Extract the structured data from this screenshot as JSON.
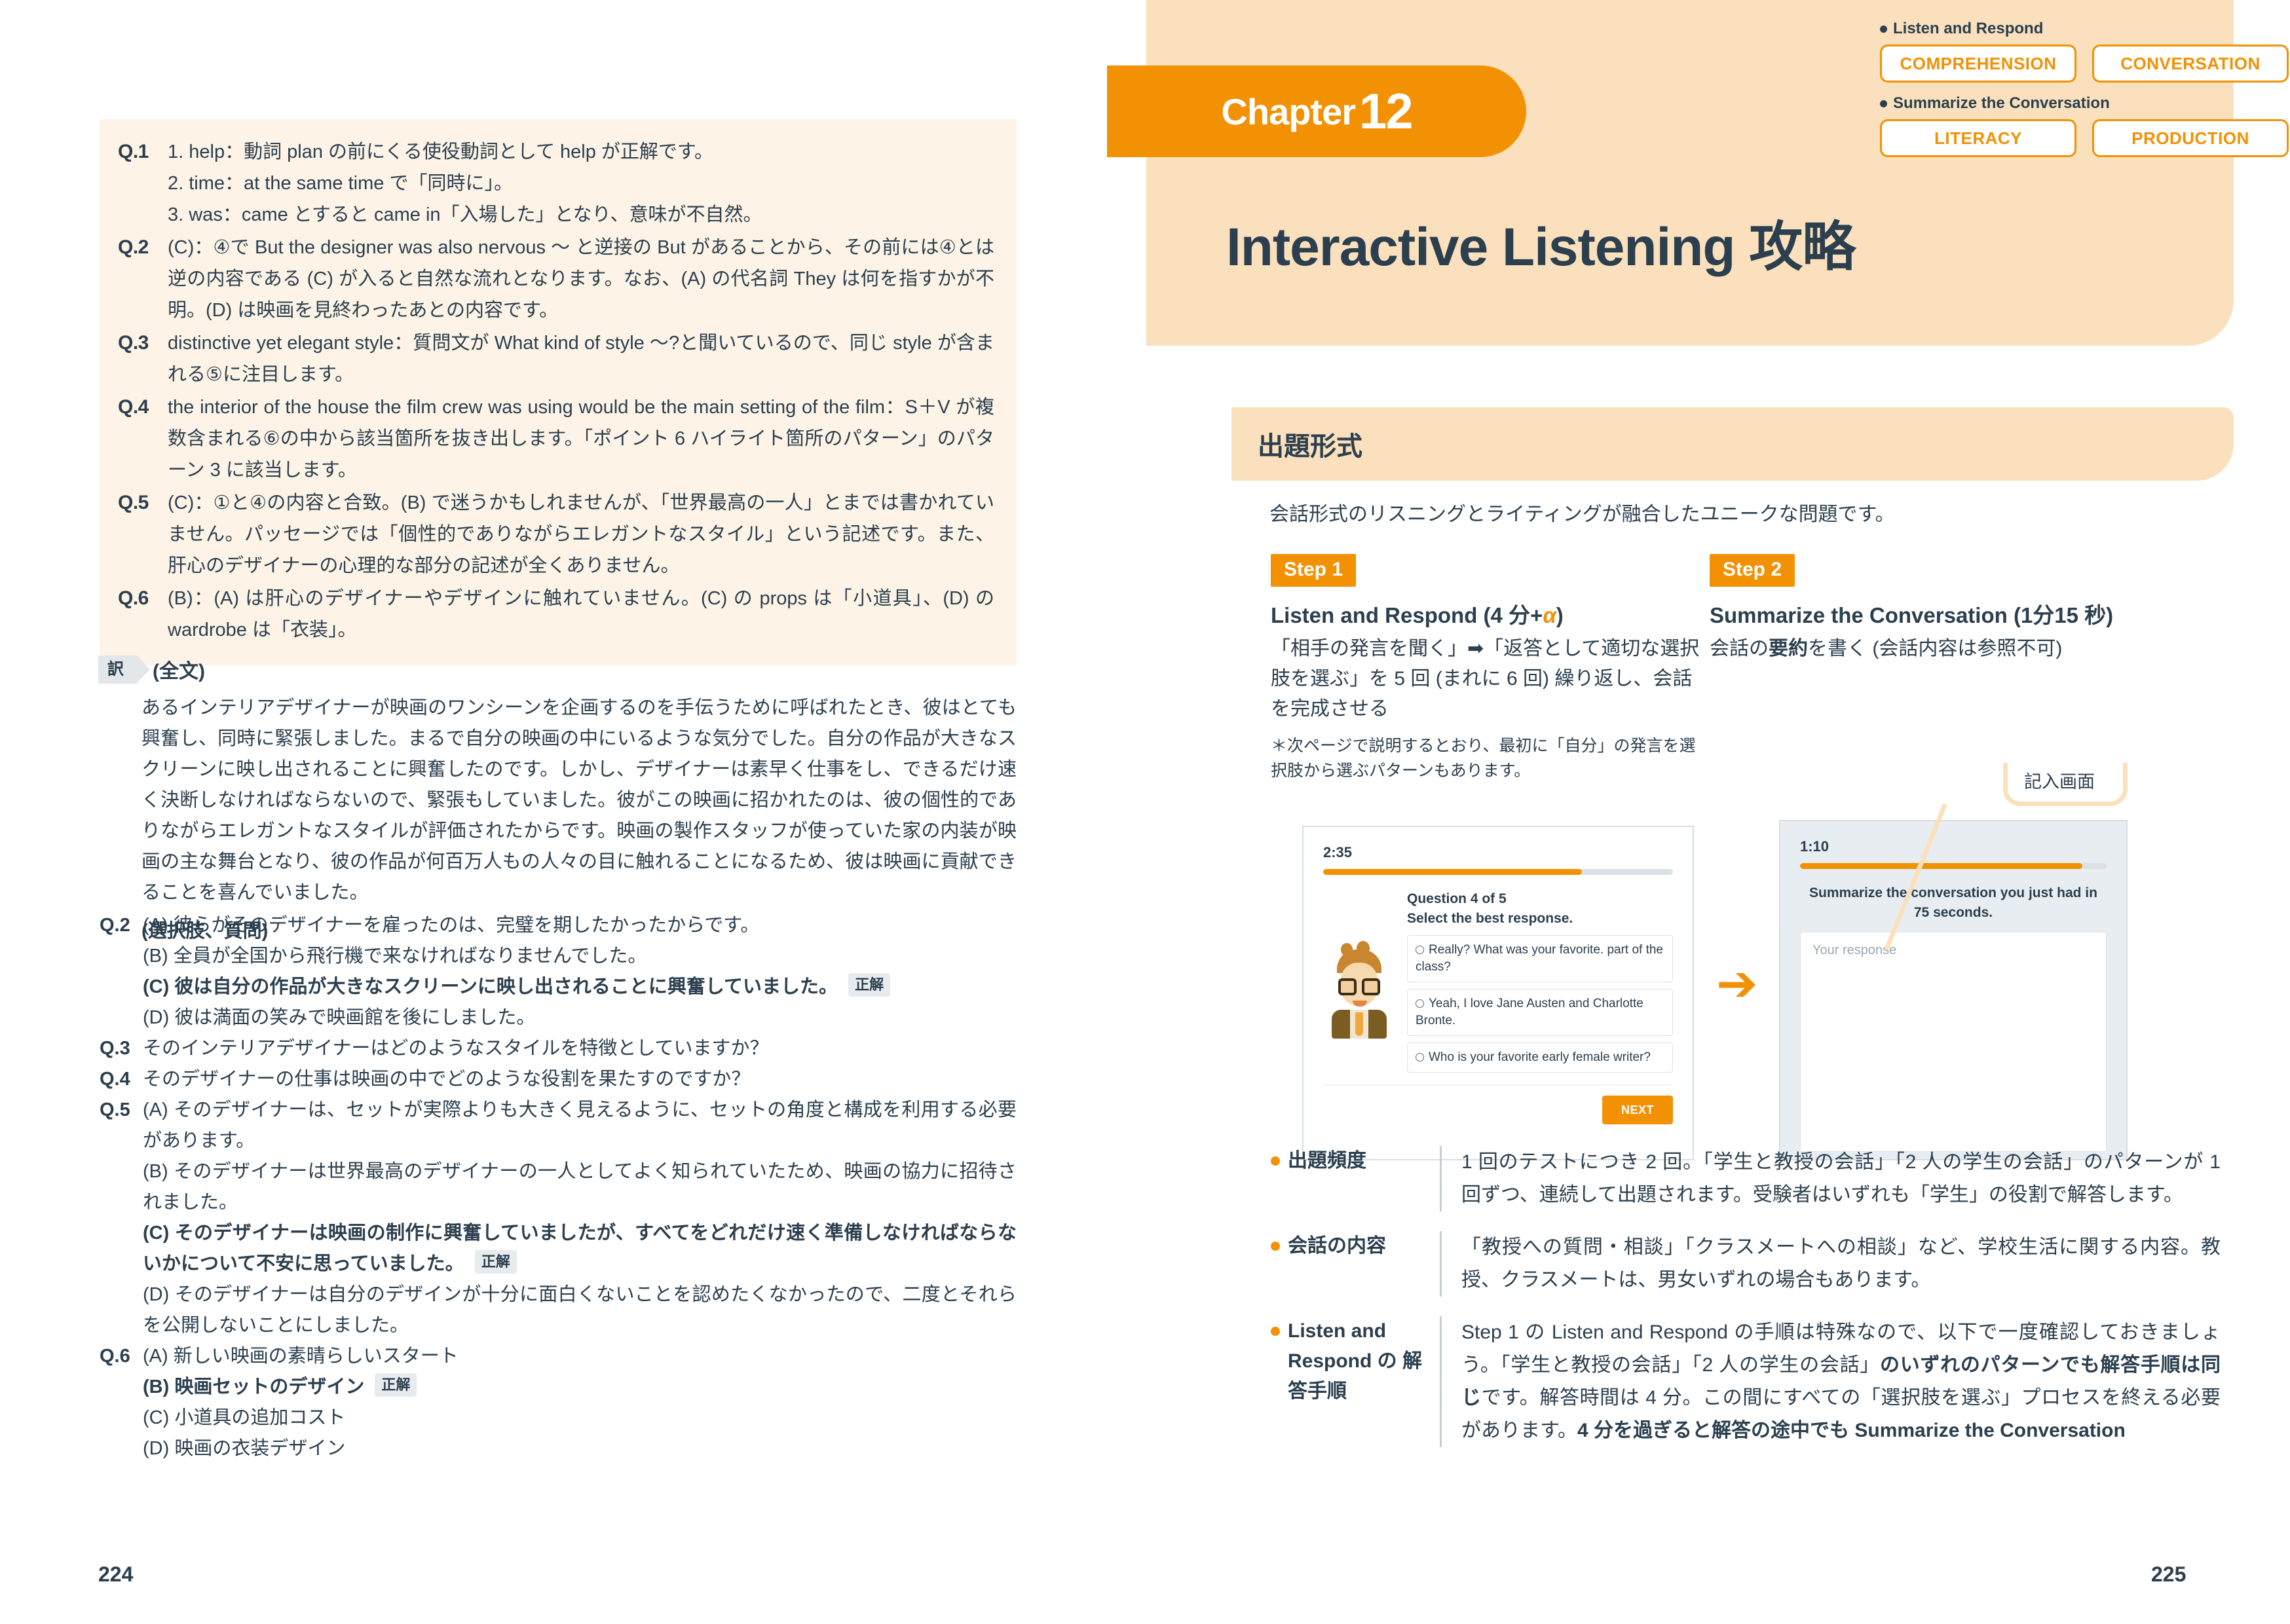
{
  "left_page": {
    "page_number": "224",
    "explanations": [
      {
        "label": "Q.1",
        "lines": [
          "1. help：動詞 plan の前にくる使役動詞として help が正解です。",
          "2. time：at the same time で「同時に」。",
          "3. was：came とすると came in「入場した」となり、意味が不自然。"
        ]
      },
      {
        "label": "Q.2",
        "lines": [
          "(C)：④で But the designer was also nervous 〜 と逆接の But があることから、その前には④とは逆の内容である (C) が入ると自然な流れとなります。なお、(A) の代名詞 They は何を指すかが不明。(D) は映画を見終わったあとの内容です。"
        ]
      },
      {
        "label": "Q.3",
        "lines": [
          "distinctive yet elegant style：質問文が What kind of style 〜?と聞いているので、同じ style が含まれる⑤に注目します。"
        ]
      },
      {
        "label": "Q.4",
        "lines": [
          "the interior of the house the film crew was using would be the main setting of the film：S＋V が複数含まれる⑥の中から該当箇所を抜き出します。「ポイント 6 ハイライト箇所のパターン」のパターン 3 に該当します。"
        ]
      },
      {
        "label": "Q.5",
        "lines": [
          "(C)：①と④の内容と合致。(B) で迷うかもしれませんが、「世界最高の一人」とまでは書かれていません。パッセージでは「個性的でありながらエレガントなスタイル」という記述です。また、肝心のデザイナーの心理的な部分の記述が全くありません。"
        ]
      },
      {
        "label": "Q.6",
        "lines": [
          "(B)：(A) は肝心のデザイナーやデザインに触れていません。(C) の props は「小道具」、(D) の wardrobe は「衣装」。"
        ]
      }
    ],
    "translation": {
      "tag": "訳",
      "title": "(全文)",
      "body": "あるインテリアデザイナーが映画のワンシーンを企画するのを手伝うために呼ばれたとき、彼はとても興奮し、同時に緊張しました。まるで自分の映画の中にいるような気分でした。自分の作品が大きなスクリーンに映し出されることに興奮したのです。しかし、デザイナーは素早く仕事をし、できるだけ速く決断しなければならないので、緊張もしていました。彼がこの映画に招かれたのは、彼の個性的でありながらエレガントなスタイルが評価されたからです。映画の製作スタッフが使っていた家の内装が映画の主な舞台となり、彼の作品が何百万人もの人々の目に触れることになるため、彼は映画に貢献できることを喜んでいました。",
      "choices_heading": "(選択肢、質問)"
    },
    "choice_groups": [
      {
        "label": "Q.2",
        "items": [
          {
            "tag": "(A)",
            "text": "彼らがそのデザイナーを雇ったのは、完璧を期したかったからです。",
            "correct": false
          },
          {
            "tag": "(B)",
            "text": "全員が全国から飛行機で来なければなりませんでした。",
            "correct": false
          },
          {
            "tag": "(C)",
            "text": "彼は自分の作品が大きなスクリーンに映し出されることに興奮していました。",
            "correct": true
          },
          {
            "tag": "(D)",
            "text": "彼は満面の笑みで映画館を後にしました。",
            "correct": false
          }
        ]
      },
      {
        "label": "Q.3",
        "items": [
          {
            "tag": "",
            "text": "そのインテリアデザイナーはどのようなスタイルを特徴としていますか？",
            "correct": false
          }
        ]
      },
      {
        "label": "Q.4",
        "items": [
          {
            "tag": "",
            "text": "そのデザイナーの仕事は映画の中でどのような役割を果たすのですか？",
            "correct": false
          }
        ]
      },
      {
        "label": "Q.5",
        "items": [
          {
            "tag": "(A)",
            "text": "そのデザイナーは、セットが実際よりも大きく見えるように、セットの角度と構成を利用する必要があります。",
            "correct": false
          },
          {
            "tag": "(B)",
            "text": "そのデザイナーは世界最高のデザイナーの一人としてよく知られていたため、映画の協力に招待されました。",
            "correct": false
          },
          {
            "tag": "(C)",
            "text": "そのデザイナーは映画の制作に興奮していましたが、すべてをどれだけ速く準備しなければならないかについて不安に思っていました。",
            "correct": true
          },
          {
            "tag": "(D)",
            "text": "そのデザイナーは自分のデザインが十分に面白くないことを認めたくなかったので、二度とそれらを公開しないことにしました。",
            "correct": false
          }
        ]
      },
      {
        "label": "Q.6",
        "items": [
          {
            "tag": "(A)",
            "text": "新しい映画の素晴らしいスタート",
            "correct": false
          },
          {
            "tag": "(B)",
            "text": "映画セットのデザイン",
            "correct": true
          },
          {
            "tag": "(C)",
            "text": "小道具の追加コスト",
            "correct": false
          },
          {
            "tag": "(D)",
            "text": "映画の衣装デザイン",
            "correct": false
          }
        ]
      }
    ],
    "correct_badge": "正解"
  },
  "right_page": {
    "page_number": "225",
    "chapter": {
      "word": "Chapter",
      "number": "12"
    },
    "skills": [
      {
        "lead": "Listen and Respond",
        "chips": [
          "COMPREHENSION",
          "CONVERSATION"
        ]
      },
      {
        "lead": "Summarize the Conversation",
        "chips": [
          "LITERACY",
          "PRODUCTION"
        ]
      }
    ],
    "title": "Interactive Listening 攻略",
    "section": {
      "heading": "出題形式",
      "lead": "会話形式のリスニングとライティングが融合したユニークな問題です。"
    },
    "steps": [
      {
        "chip": "Step 1",
        "title_pre": "Listen and Respond (4 分+",
        "title_alpha": "α",
        "title_post": ")",
        "desc": "「相手の発言を聞く」➡「返答として適切な選択肢を選ぶ」を 5 回 (まれに 6 回) 繰り返し、会話を完成させる",
        "note": "＊次ページで説明するとおり、最初に「自分」の発言を選択肢から選ぶパターンもあります。"
      },
      {
        "chip": "Step 2",
        "title_pre": "Summarize the Conversation (1分15 秒)",
        "title_alpha": "",
        "title_post": "",
        "desc_pre": "会話の",
        "desc_bold": "要約",
        "desc_post": "を書く (会話内容は参照不可)",
        "note": ""
      }
    ],
    "mock_left": {
      "timer": "2:35",
      "progress_percent": 74,
      "question_line1": "Question 4 of 5",
      "question_line2": "Select the best response.",
      "options": [
        "Really? What was your favorite. part of the class?",
        "Yeah, I love Jane Austen and Charlotte Bronte.",
        "Who is your favorite early female writer?"
      ],
      "next_label": "NEXT"
    },
    "mock_right": {
      "timer": "1:10",
      "progress_percent": 92,
      "prompt": "Summarize the conversation you just had in 75 seconds.",
      "response_placeholder": "Your response"
    },
    "callout": "記入画面",
    "arrow": "➔",
    "bullets": [
      {
        "term": "出題頻度",
        "desc": "1 回のテストにつき 2 回。「学生と教授の会話」「2 人の学生の会話」のパターンが 1 回ずつ、連続して出題されます。受験者はいずれも「学生」の役割で解答します。"
      },
      {
        "term": "会話の内容",
        "desc": "「教授への質問・相談」「クラスメートへの相談」など、学校生活に関する内容。教授、クラスメートは、男女いずれの場合もあります。"
      },
      {
        "term": "Listen and Respond の 解答手順",
        "desc_pre": "Step 1 の Listen and Respond の手順は特殊なので、以下で一度確認しておきましょう。「学生と教授の会話」「2 人の学生の会話」",
        "desc_bold1": "のいずれのパターンでも解答手順は同じ",
        "desc_mid": "です。解答時間は 4 分。この間にすべての「選択肢を選ぶ」プロセスを終える必要があります。",
        "desc_bold2": "4 分を過ぎると解答の途中でも Summarize the Conversation"
      }
    ]
  },
  "colors": {
    "accent_orange": "#f29104",
    "header_peach": "#fbe0bd",
    "explain_cream": "#fdf3e6",
    "ink": "#2b3f4e",
    "rule_gray": "#c5cfd7"
  }
}
